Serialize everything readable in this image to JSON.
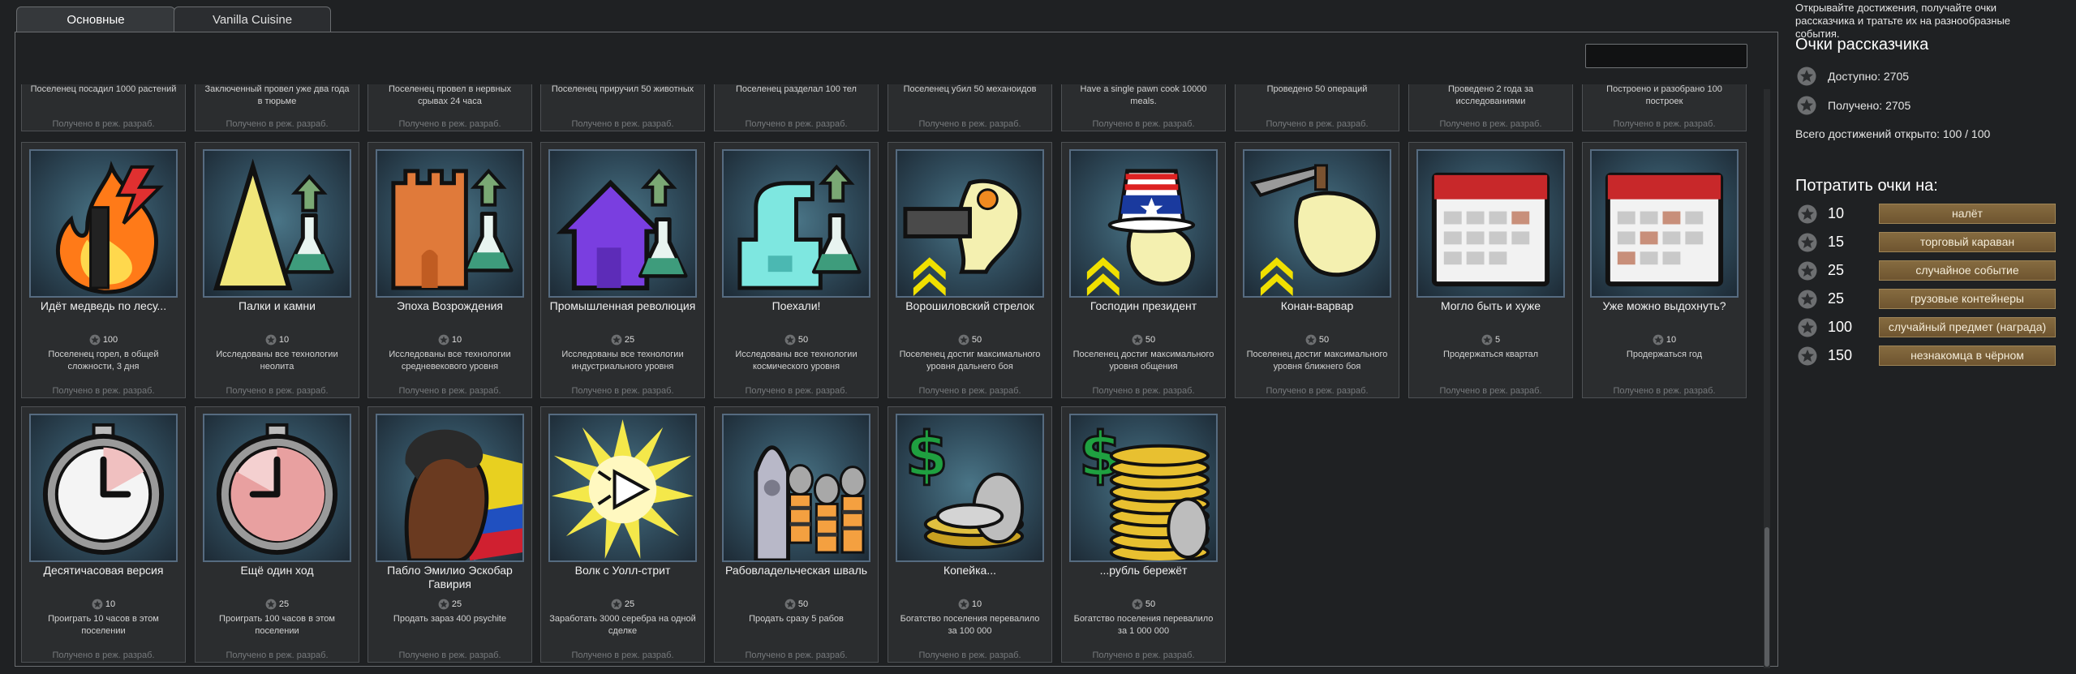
{
  "tabs": [
    {
      "label": "Основные",
      "active": true
    },
    {
      "label": "Vanilla Cuisine",
      "active": false
    }
  ],
  "search": {
    "value": ""
  },
  "status_text": "Получено в реж. разраб.",
  "top_row": [
    {
      "desc": "Поселенец посадил 1000 растений"
    },
    {
      "desc": "Заключенный провел уже два года в тюрьме"
    },
    {
      "desc": "Поселенец провел в нервных срывах 24 часа"
    },
    {
      "desc": "Поселенец приручил 50 животных"
    },
    {
      "desc": "Поселенец разделал 100 тел"
    },
    {
      "desc": "Поселенец убил 50 механоидов"
    },
    {
      "desc": "Have a single pawn cook 10000 meals."
    },
    {
      "desc": "Проведено 50 операций"
    },
    {
      "desc": "Проведено 2 года за исследованиями"
    },
    {
      "desc": "Построено и разобрано 100 построек"
    }
  ],
  "row2": [
    {
      "title": "Идёт медведь по лесу...",
      "points": "100",
      "desc": "Поселенец горел, в общей сложности, 3 дня",
      "icon": "fire-icon"
    },
    {
      "title": "Палки и камни",
      "points": "10",
      "desc": "Исследованы все технологии неолита",
      "icon": "neolithic-tech-icon"
    },
    {
      "title": "Эпоха Возрождения",
      "points": "10",
      "desc": "Исследованы все технологии средневекового уровня",
      "icon": "castle-tech-icon"
    },
    {
      "title": "Промышленная революция",
      "points": "25",
      "desc": "Исследованы все технологии индустриального уровня",
      "icon": "industrial-house-icon"
    },
    {
      "title": "Поехали!",
      "points": "50",
      "desc": "Исследованы все технологии космического уровня",
      "icon": "spacer-machine-icon"
    },
    {
      "title": "Ворошиловский стрелок",
      "points": "50",
      "desc": "Поселенец достиг максимального уровня дальнего боя",
      "icon": "shooter-icon"
    },
    {
      "title": "Господин президент",
      "points": "50",
      "desc": "Поселенец достиг максимального уровня общения",
      "icon": "president-hat-icon"
    },
    {
      "title": "Конан-варвар",
      "points": "50",
      "desc": "Поселенец достиг максимального уровня ближнего боя",
      "icon": "barbarian-icon"
    },
    {
      "title": "Могло быть и хуже",
      "points": "5",
      "desc": "Продержаться квартал",
      "icon": "calendar-icon"
    },
    {
      "title": "Уже можно выдохнуть?",
      "points": "10",
      "desc": "Продержаться год",
      "icon": "calendar-year-icon"
    }
  ],
  "row3": [
    {
      "title": "Десятичасовая версия",
      "points": "10",
      "desc": "Проиграть 10 часов в этом поселении",
      "icon": "stopwatch-icon"
    },
    {
      "title": "Ещё один ход",
      "points": "25",
      "desc": "Проиграть 100 часов в этом поселении",
      "icon": "stopwatch-red-icon"
    },
    {
      "title": "Пабло Эмилио Эскобар Гавирия",
      "points": "25",
      "desc": "Продать зараз 400 psychite",
      "icon": "escobar-icon"
    },
    {
      "title": "Волк с Уолл-стрит",
      "points": "25",
      "desc": "Заработать 3000 серебра на одной сделке",
      "icon": "trade-burst-icon"
    },
    {
      "title": "Рабовладельческая шваль",
      "points": "50",
      "desc": "Продать сразу 5 рабов",
      "icon": "slaves-icon"
    },
    {
      "title": "Копейка...",
      "points": "10",
      "desc": "Богатство поселения перевалило за 100 000",
      "icon": "coins-small-icon"
    },
    {
      "title": "...рубль бережёт",
      "points": "50",
      "desc": "Богатство поселения перевалило за 1 000 000",
      "icon": "coins-big-icon"
    }
  ],
  "sidebar": {
    "hint": "Открывайте достижения, получайте очки рассказчика и тратьте их на разнообразные события.",
    "title": "Очки рассказчика",
    "available": "Доступно: 2705",
    "received": "Получено: 2705",
    "total": "Всего достижений открыто: 100 / 100",
    "spend_title": "Потратить очки на:",
    "options": [
      {
        "cost": "10",
        "label": "налёт"
      },
      {
        "cost": "15",
        "label": "торговый караван"
      },
      {
        "cost": "25",
        "label": "случайное событие"
      },
      {
        "cost": "25",
        "label": "грузовые контейнеры"
      },
      {
        "cost": "100",
        "label": "случайный предмет (награда)"
      },
      {
        "cost": "150",
        "label": "незнакомца в чёрном"
      }
    ]
  }
}
